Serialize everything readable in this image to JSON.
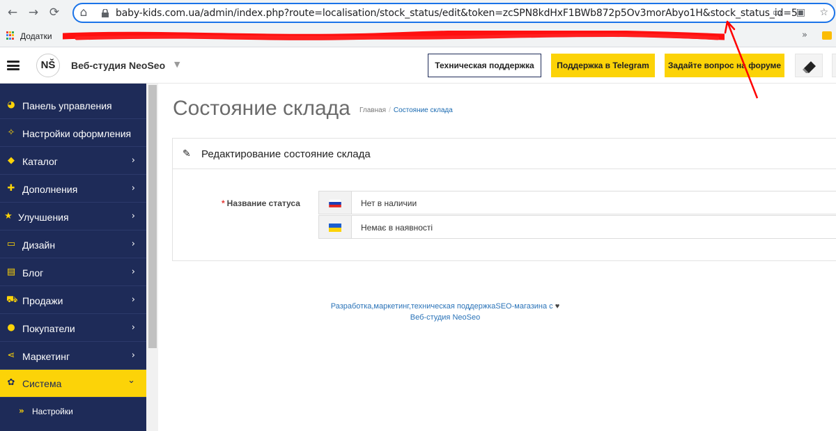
{
  "browser": {
    "back": "←",
    "forward": "→",
    "reload": "⟳",
    "home": "⌂",
    "url": "baby-kids.com.ua/admin/index.php?route=localisation/stock_status/edit&token=zcSPN8kdHxF1BWb872p5Ov3morAbyo1H&stock_status_id=5",
    "bookmarks_label": "Додатки",
    "more": "»"
  },
  "header": {
    "logo": "NŠ",
    "brand": "Веб-студия NeoSeo",
    "caret": "▼",
    "tech_support": "Техническая поддержка",
    "telegram": "Поддержка в Telegram",
    "forum": "Задайте вопрос на форуме"
  },
  "sidebar": {
    "items": [
      {
        "label": "Панель управления",
        "icon": "dashboard-icon",
        "glyph": "◕"
      },
      {
        "label": "Настройки оформления",
        "icon": "magic-wand-icon",
        "glyph": "✧"
      },
      {
        "label": "Каталог",
        "icon": "tag-icon",
        "glyph": "◆"
      },
      {
        "label": "Дополнения",
        "icon": "puzzle-icon",
        "glyph": "✚"
      },
      {
        "label": "Улучшения",
        "icon": "star-icon",
        "glyph": "★"
      },
      {
        "label": "Дизайн",
        "icon": "monitor-icon",
        "glyph": "▭"
      },
      {
        "label": "Блог",
        "icon": "file-icon",
        "glyph": "▤"
      },
      {
        "label": "Продажи",
        "icon": "cart-icon",
        "glyph": "⛟"
      },
      {
        "label": "Покупатели",
        "icon": "user-icon",
        "glyph": "●"
      },
      {
        "label": "Маркетинг",
        "icon": "share-icon",
        "glyph": "⋖"
      },
      {
        "label": "Система",
        "icon": "cog-icon",
        "glyph": "✿"
      }
    ],
    "arrow": "›",
    "arrow_open": "⌄",
    "sub_item": {
      "label": "Настройки",
      "glyph": "»"
    }
  },
  "content": {
    "title": "Состояние склада",
    "breadcrumb_home": "Главная",
    "breadcrumb_sep": "/",
    "breadcrumb_current": "Состояние склада",
    "panel_title": "Редактирование состояние склада",
    "field_label": "Название статуса",
    "required_mark": "*",
    "inputs": [
      {
        "value": "Нет в наличии",
        "flag": "ru"
      },
      {
        "value": "Немає в наявності",
        "flag": "ua"
      }
    ]
  },
  "footer": {
    "line1": "Разработка,маркетинг,техническая поддержкаSEO-магазина с",
    "heart": "♥",
    "line2": "Веб-студия NeoSeo"
  },
  "colors": {
    "sidebar_bg": "#1e2b58",
    "accent_yellow": "#fcd308",
    "link_blue": "#1a6ab1",
    "annotation_red": "#ff0000"
  }
}
